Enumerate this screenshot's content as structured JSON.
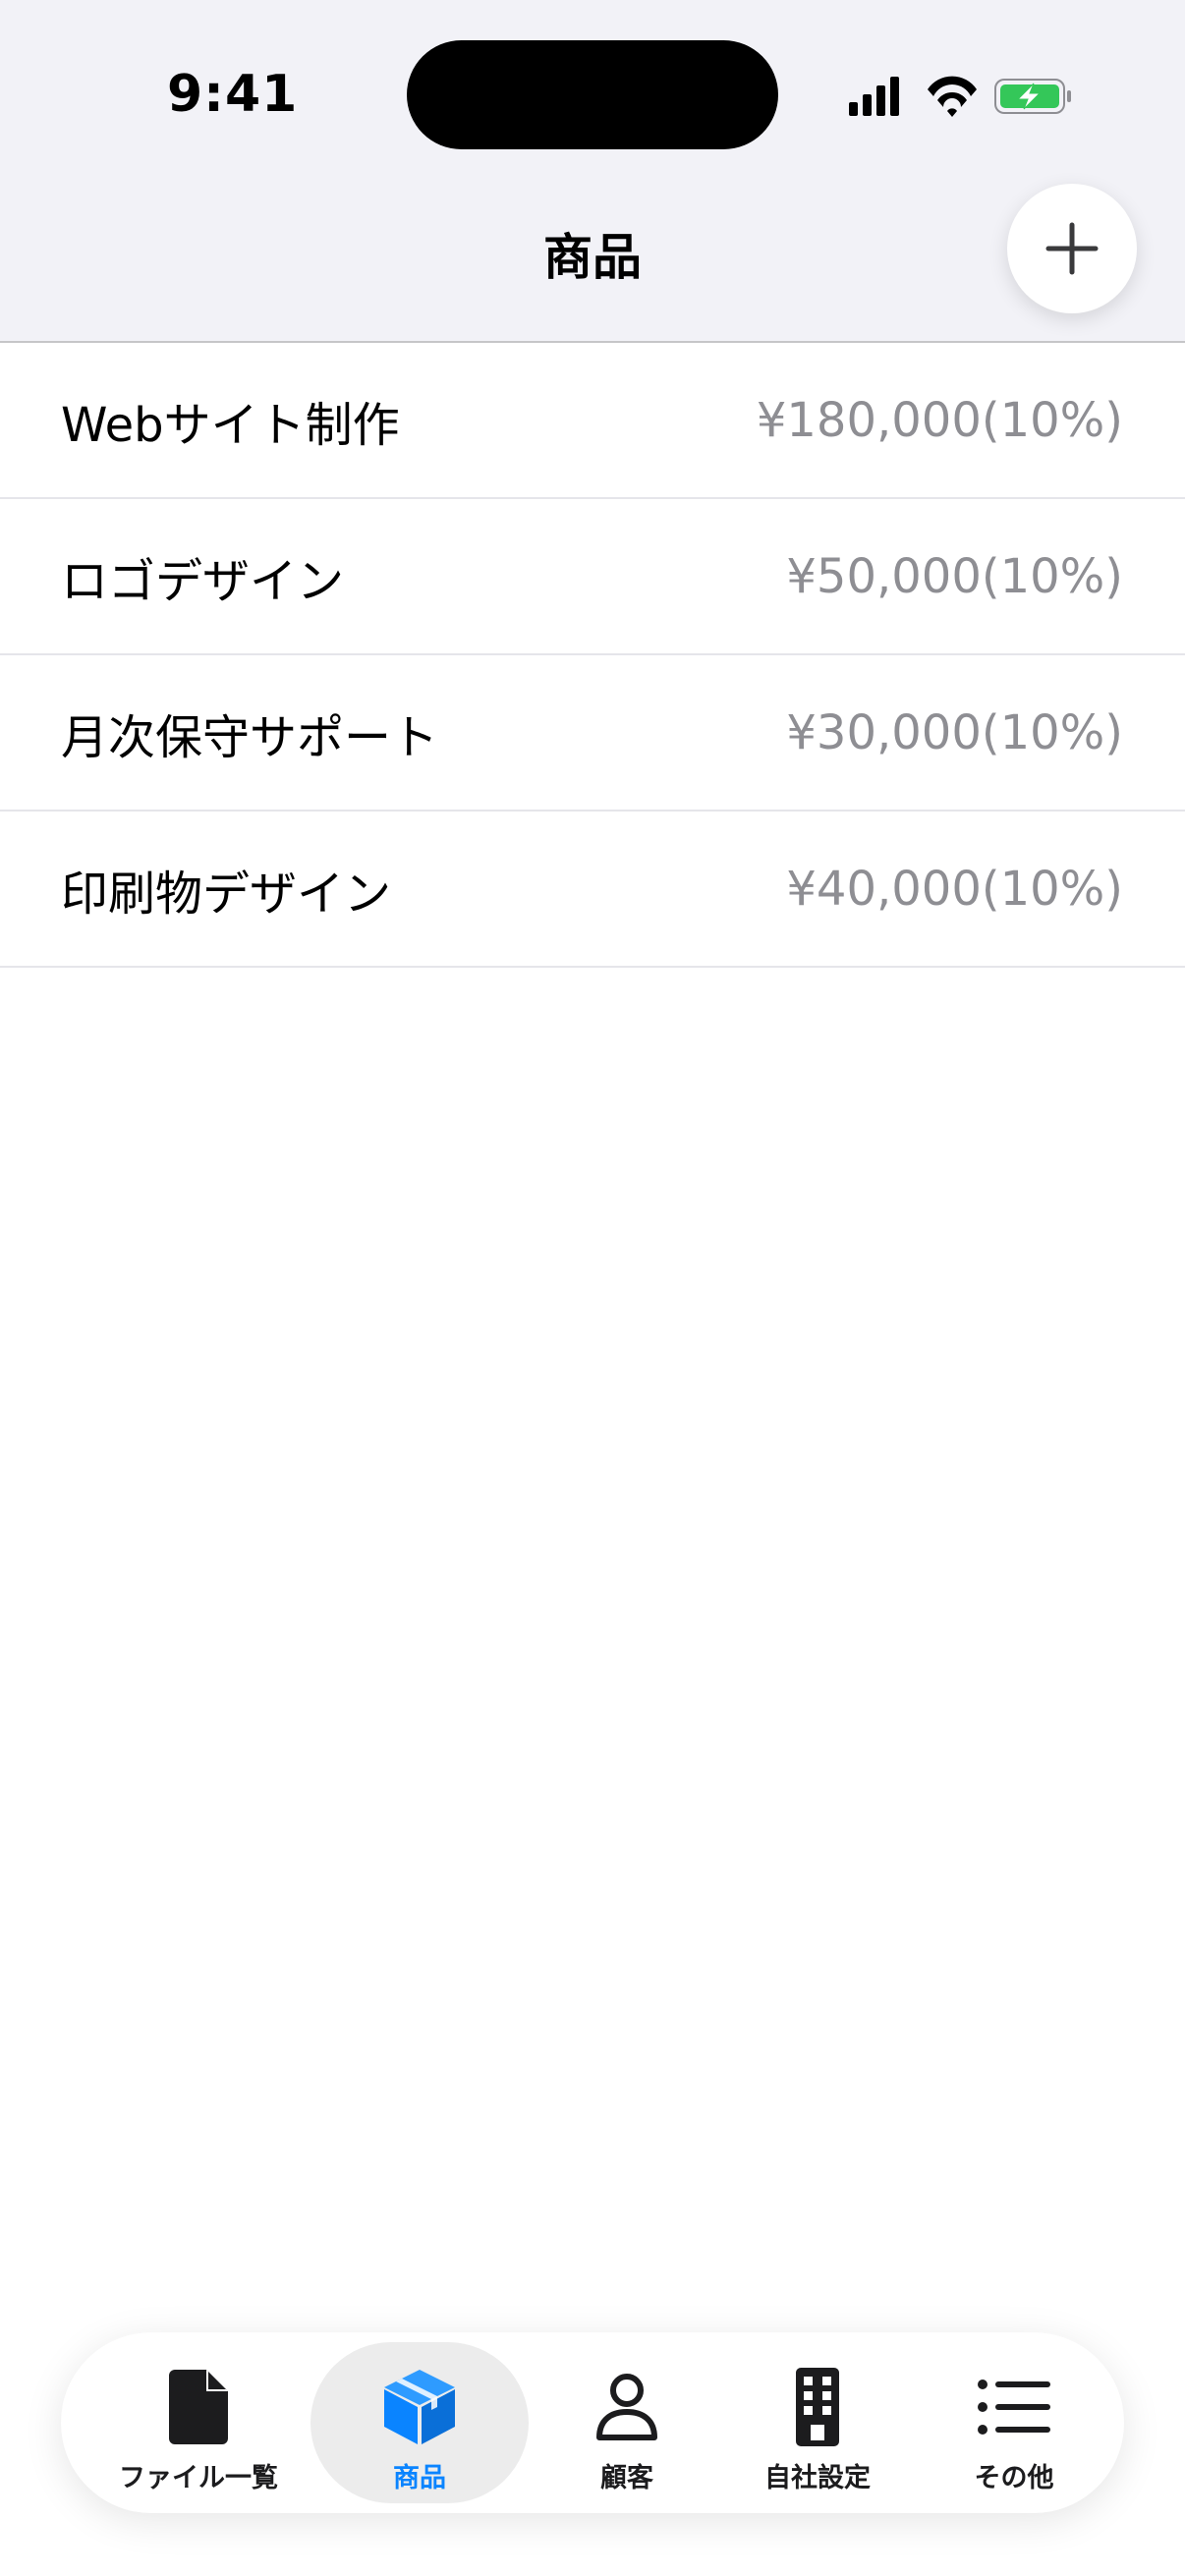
{
  "status_bar": {
    "time": "9:41"
  },
  "header": {
    "title": "商品"
  },
  "products": [
    {
      "name": "Webサイト制作",
      "price": "¥180,000(10%)"
    },
    {
      "name": "ロゴデザイン",
      "price": "¥50,000(10%)"
    },
    {
      "name": "月次保守サポート",
      "price": "¥30,000(10%)"
    },
    {
      "name": "印刷物デザイン",
      "price": "¥40,000(10%)"
    }
  ],
  "tabs": [
    {
      "label": "ファイル一覧",
      "icon": "document-icon",
      "active": false
    },
    {
      "label": "商品",
      "icon": "box-icon",
      "active": true
    },
    {
      "label": "顧客",
      "icon": "person-icon",
      "active": false
    },
    {
      "label": "自社設定",
      "icon": "building-icon",
      "active": false
    },
    {
      "label": "その他",
      "icon": "list-icon",
      "active": false
    }
  ],
  "colors": {
    "accent": "#0a84ff",
    "battery": "#34c759",
    "header_bg": "#f2f2f7",
    "secondary_text": "#8e8e93"
  }
}
